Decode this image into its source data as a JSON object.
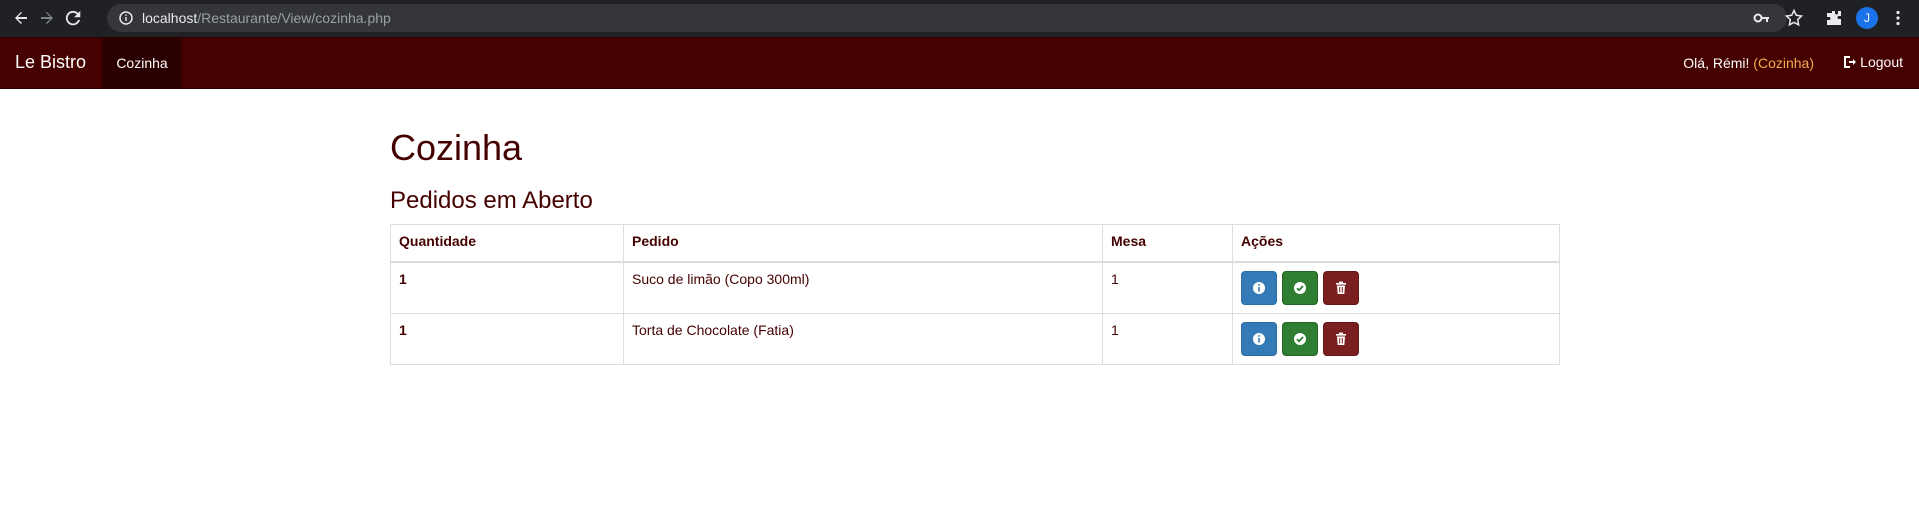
{
  "browser": {
    "url_host": "localhost",
    "url_path": "/Restaurante/View/cozinha.php",
    "profile_initial": "J"
  },
  "navbar": {
    "brand": "Le Bistro",
    "active_item": "Cozinha",
    "greeting": "Olá, Rémi!",
    "role": "(Cozinha)",
    "logout_label": "Logout"
  },
  "page": {
    "title": "Cozinha",
    "section_title": "Pedidos em Aberto"
  },
  "table": {
    "headers": [
      "Quantidade",
      "Pedido",
      "Mesa",
      "Ações"
    ],
    "rows": [
      {
        "quantidade": "1",
        "pedido": "Suco de limão (Copo 300ml)",
        "mesa": "1"
      },
      {
        "quantidade": "1",
        "pedido": "Torta de Chocolate (Fatia)",
        "mesa": "1"
      }
    ]
  },
  "colors": {
    "navbar": "#450000",
    "accent_text": "#450000",
    "info": "#337ab7",
    "success": "#2e7d32",
    "danger": "#7a1f1f",
    "role_highlight": "#f0ad4e"
  },
  "icons": {
    "info": "info-circle-icon",
    "confirm": "check-circle-icon",
    "delete": "trash-icon",
    "logout": "log-out-icon"
  }
}
